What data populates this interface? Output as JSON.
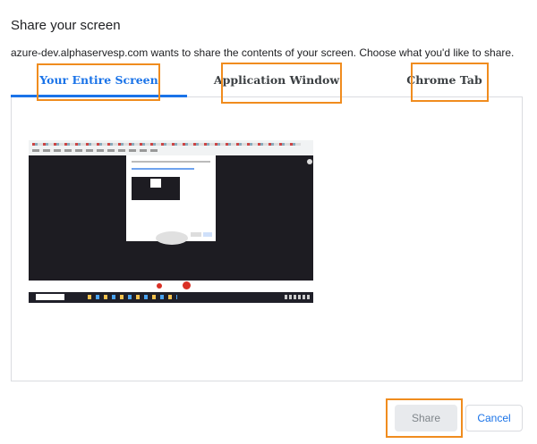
{
  "dialog": {
    "title": "Share your screen",
    "subtitle": "azure-dev.alphaservesp.com wants to share the contents of your screen. Choose what you'd like to share."
  },
  "tabs": [
    {
      "label": "Your Entire Screen",
      "active": true
    },
    {
      "label": "Application Window",
      "active": false
    },
    {
      "label": "Chrome Tab",
      "active": false
    }
  ],
  "buttons": {
    "share_label": "Share",
    "share_enabled": false,
    "cancel_label": "Cancel"
  },
  "colors": {
    "accent": "#1a73e8",
    "highlight": "#f08c1e",
    "disabled_bg": "#e8eaed"
  },
  "preview": {
    "description_icon": "screen-thumbnail"
  }
}
